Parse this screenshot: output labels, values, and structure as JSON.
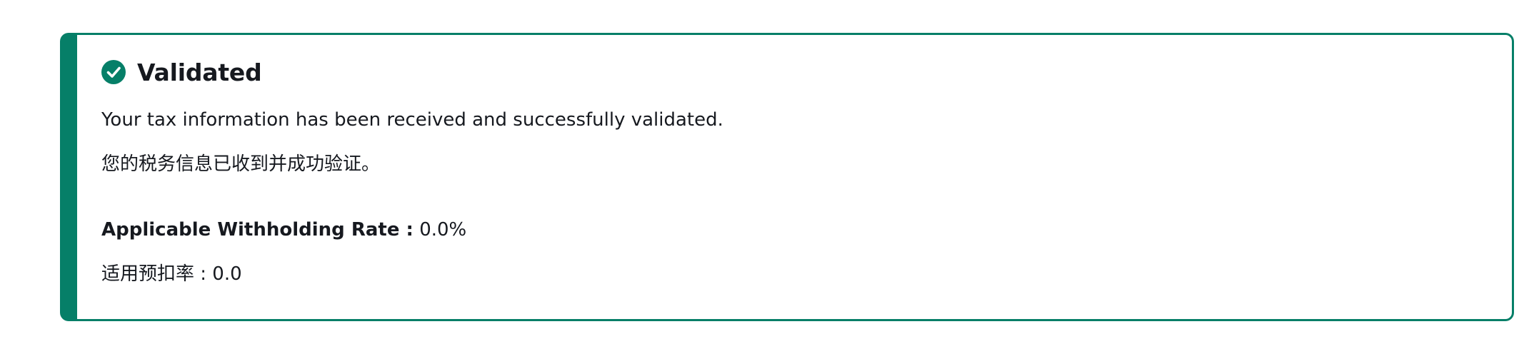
{
  "alert": {
    "status_icon": "check-circle-icon",
    "title": "Validated",
    "message_en": "Your tax information has been received and successfully validated.",
    "message_zh": "您的税务信息已收到并成功验证。",
    "rate_label": "Applicable Withholding Rate :",
    "rate_value": "0.0%",
    "rate_label_zh": "适用预扣率 :",
    "rate_value_zh": "0.0"
  },
  "colors": {
    "success_accent": "#067f68",
    "text": "#16191f",
    "background": "#ffffff"
  }
}
